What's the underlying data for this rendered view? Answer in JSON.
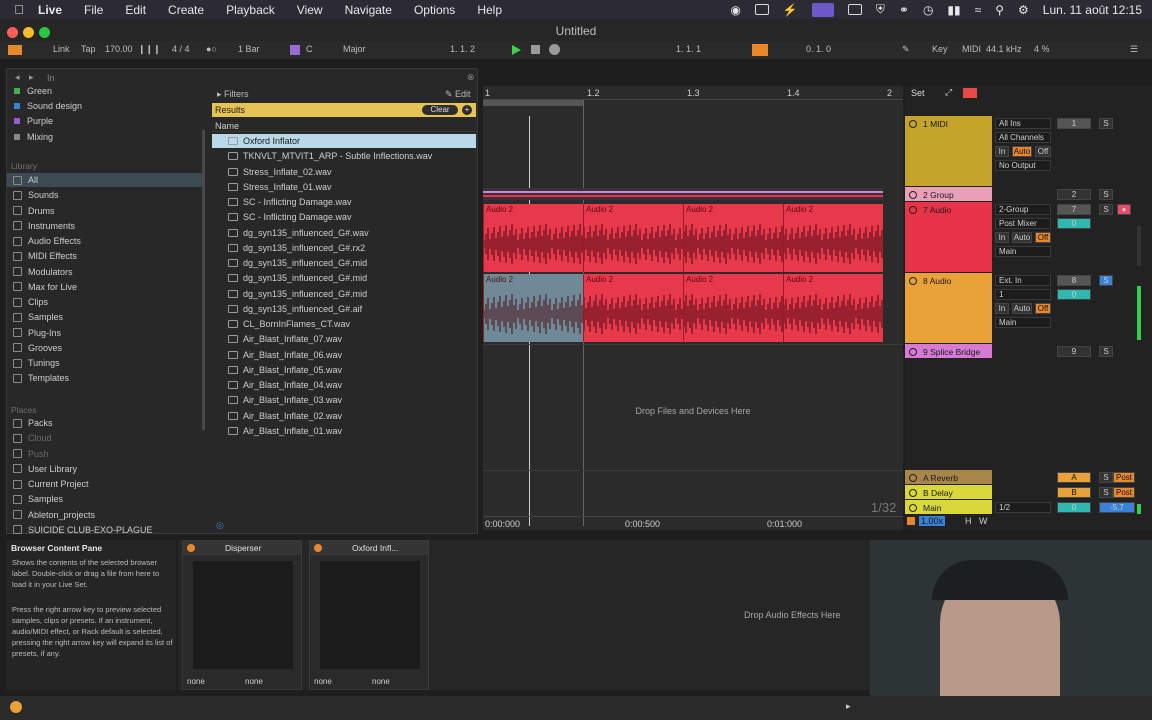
{
  "menubar": {
    "items": [
      "Live",
      "File",
      "Edit",
      "Create",
      "Playback",
      "View",
      "Navigate",
      "Options",
      "Help"
    ],
    "clock": "Lun. 11 août  12:15"
  },
  "window": {
    "title": "Untitled"
  },
  "control_bar": {
    "link": "Link",
    "tap": "Tap",
    "tempo": "170.00",
    "signature": "4 / 4",
    "quant": "1 Bar",
    "key": "C",
    "scale": "Major",
    "position": "1.   1.   2",
    "loop_start": "1.   1.   1",
    "loop_len": "0.   1.   0",
    "key_label": "Key",
    "midi_label": "MIDI",
    "sample_rate": "44.1 kHz",
    "cpu": "4 %"
  },
  "browser": {
    "search_placeholder": "In",
    "collections": [
      {
        "label": "Green",
        "color": "#3fb24a"
      },
      {
        "label": "Sound design",
        "color": "#3a82d6"
      },
      {
        "label": "Purple",
        "color": "#9e57d6"
      },
      {
        "label": "Mixing",
        "color": "#888888"
      }
    ],
    "library_header": "Library",
    "library": [
      "All",
      "Sounds",
      "Drums",
      "Instruments",
      "Audio Effects",
      "MIDI Effects",
      "Modulators",
      "Max for Live",
      "Clips",
      "Samples",
      "Plug-Ins",
      "Grooves",
      "Tunings",
      "Templates"
    ],
    "places_header": "Places",
    "places": [
      "Packs",
      "Cloud",
      "Push",
      "User Library",
      "Current Project",
      "Samples",
      "Ableton_projects",
      "SUICIDE CLUB-EXO-PLAGUE"
    ],
    "filters_label": "Filters",
    "edit_label": "Edit",
    "results_label": "Results",
    "clear_label": "Clear",
    "column_name": "Name",
    "files": [
      "Oxford Inflator",
      "TKNVLT_MTVIT1_ARP - Subtle Inflections.wav",
      "Stress_Inflate_02.wav",
      "Stress_Inflate_01.wav",
      "SC - Inflicting Damage.wav",
      "SC - Inflicting Damage.wav",
      "dg_syn135_influenced_G#.wav",
      "dg_syn135_influenced_G#.rx2",
      "dg_syn135_influenced_G#.mid",
      "dg_syn135_influenced_G#.mid",
      "dg_syn135_influenced_G#.mid",
      "dg_syn135_influenced_G#.aif",
      "CL_BornInFlames_CT.wav",
      "Air_Blast_Inflate_07.wav",
      "Air_Blast_Inflate_06.wav",
      "Air_Blast_Inflate_05.wav",
      "Air_Blast_Inflate_04.wav",
      "Air_Blast_Inflate_03.wav",
      "Air_Blast_Inflate_02.wav",
      "Air_Blast_Inflate_01.wav"
    ]
  },
  "arrangement": {
    "ruler": [
      "1",
      "1.2",
      "1.3",
      "1.4",
      "2"
    ],
    "time_ruler": [
      "0:00:000",
      "0:00:500",
      "0:01:000"
    ],
    "clip_name": "Audio 2",
    "drop_text": "Drop Files and Devices Here",
    "zoom_label": "1/32"
  },
  "mixer": {
    "set_label": "Set",
    "tracks": [
      {
        "name": "1 MIDI",
        "color": "#c4a42a"
      },
      {
        "name": "2 Group",
        "color": "#e8a0b8"
      },
      {
        "name": "7 Audio",
        "color": "#e83448"
      },
      {
        "name": "8 Audio",
        "color": "#e8a238"
      },
      {
        "name": "9 Splice Bridge",
        "color": "#d67ad6"
      },
      {
        "name": "A Reverb",
        "color": "#a8864a"
      },
      {
        "name": "B Delay",
        "color": "#d8d83a"
      },
      {
        "name": "Main",
        "color": "#d8d83a"
      }
    ],
    "io_1": [
      "All Ins",
      "All Channels",
      "No Output"
    ],
    "io_7": [
      "2-Group",
      "Post Mixer",
      "Main"
    ],
    "io_8": [
      "Ext. In",
      "1",
      "Main"
    ],
    "monitor": [
      "In",
      "Auto",
      "Off"
    ],
    "send_a": "A",
    "send_b": "B",
    "post": "Post",
    "main_fraction": "1/2",
    "main_value": "-5.7",
    "speed": "1.00x"
  },
  "info_pane": {
    "title": "Browser Content Pane",
    "text_1": "Shows the contents of the selected browser label. Double-click or drag a file from here to load it in your Live Set.",
    "text_2": "Press the right arrow key to preview selected samples, clips or presets. If an instrument, audio/MIDI effect, or Rack default is selected, pressing the right arrow key will expand its list of presets, if any."
  },
  "devices": {
    "dev1": "Disperser",
    "dev2": "Oxford Infl...",
    "none": "none",
    "drop_text": "Drop Audio Effects Here"
  }
}
